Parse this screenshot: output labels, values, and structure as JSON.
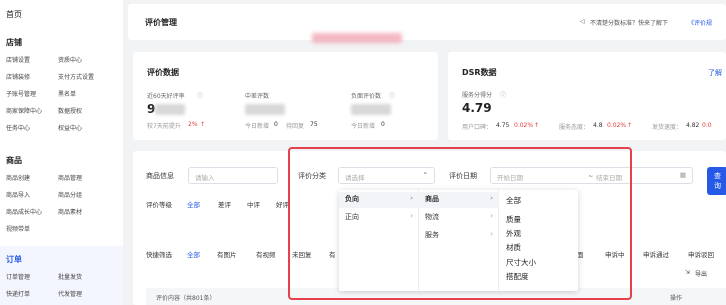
{
  "sidebar": {
    "home": "首页",
    "groups": [
      {
        "title": "店铺",
        "items": [
          "店铺设置",
          "资质中心",
          "店铺装修",
          "支付方式设置",
          "子账号管理",
          "黑名单",
          "商家保障中心",
          "数据授权",
          "任务中心",
          "权益中心"
        ]
      },
      {
        "title": "商品",
        "items": [
          "商品创建",
          "商品管理",
          "商品导入",
          "商品分组",
          "商品成长中心",
          "商品素材",
          "视频带单"
        ]
      },
      {
        "title": "订单",
        "items": [
          "订单管理",
          "批量发货",
          "快递打单",
          "代发管理"
        ]
      }
    ]
  },
  "header": {
    "title": "评价管理",
    "notice_icon": "speaker-icon",
    "notice": "不清楚分数标准？快来了解下",
    "notice_link": "《评价规"
  },
  "stats": {
    "title": "评价数据",
    "items": [
      {
        "label": "近60天好评率",
        "value": "9",
        "note": "较7天前提升",
        "delta": "2%",
        "delta_arrow": "↑"
      },
      {
        "label": "中差评数",
        "value": "",
        "note": "今日新增",
        "note_val": "0",
        "note2": "待回复",
        "note2_val": "75"
      },
      {
        "label": "负面评价数",
        "value": "",
        "note": "今日新增",
        "note_val": "0"
      }
    ]
  },
  "dsr": {
    "title": "DSR数据",
    "link": "了解",
    "label": "服务分得分",
    "value": "4.79",
    "sub": [
      {
        "label": "用户口碑：",
        "val": "4.75",
        "pct": "0.02%",
        "arrow": "↑"
      },
      {
        "label": "服务态度：",
        "val": "4.8",
        "pct": "0.02%",
        "arrow": "↑"
      },
      {
        "label": "发货速度：",
        "val": "4.82",
        "pct": "0.0"
      }
    ]
  },
  "filters": {
    "product_label": "商品信息",
    "product_ph": "请输入",
    "category_label": "评价分类",
    "category_ph": "请选择",
    "date_label": "评价日期",
    "date_start": "开始日期",
    "date_sep": "~",
    "date_end": "结束日期",
    "query": "查询",
    "rating_label": "评价等级",
    "ratings": [
      "全部",
      "差评",
      "中评",
      "好评"
    ],
    "quick_label": "快捷筛选",
    "quick": [
      "全部",
      "有图片",
      "有视频",
      "未回复",
      "有"
    ],
    "right_tabs": [
      "面",
      "申诉中",
      "申诉通过",
      "申诉驳回"
    ],
    "export": "导出"
  },
  "dropdown": {
    "col1": [
      {
        "label": "负向",
        "selected": true
      },
      {
        "label": "正向",
        "selected": false
      }
    ],
    "col2": [
      {
        "label": "商品",
        "selected": true
      },
      {
        "label": "物流",
        "selected": false
      },
      {
        "label": "服务",
        "selected": false
      }
    ],
    "col3": [
      "全部",
      "质量",
      "外观",
      "材质",
      "尺寸大小",
      "搭配度"
    ]
  },
  "table": {
    "content_header": "评价内容（共801条）",
    "ops_header": "操作"
  },
  "colors": {
    "accent": "#2659e6",
    "red": "#e83a3a",
    "highlight": "#e5414c"
  }
}
